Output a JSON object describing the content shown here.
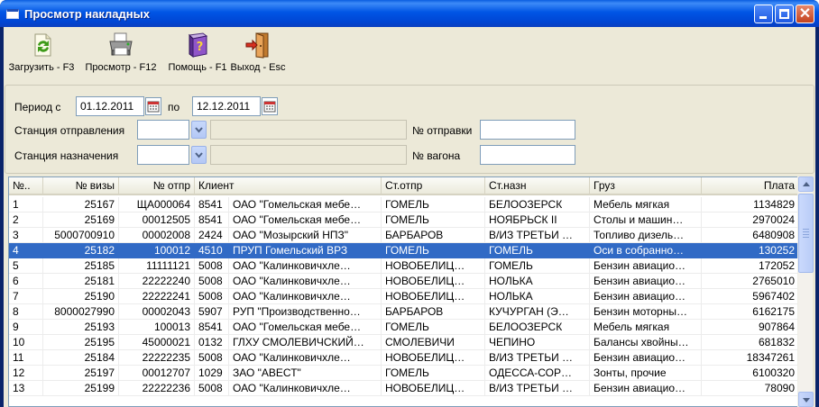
{
  "window": {
    "title": "Просмотр накладных"
  },
  "toolbar": {
    "load_label": "Загрузить - F3",
    "preview_label": "Просмотр - F12",
    "help_label": "Помощь - F1",
    "exit_label": "Выход - Esc"
  },
  "filters": {
    "period_label": "Период с",
    "date_from": "01.12.2011",
    "to_label": "по",
    "date_to": "12.12.2011",
    "station_from_label": "Станция отправления",
    "station_to_label": "Станция назначения",
    "shipment_no_label": "№ отправки",
    "wagon_no_label": "№ вагона"
  },
  "grid": {
    "columns": [
      "№..",
      "№ визы",
      "№ отпр",
      "Клиент",
      "Ст.отпр",
      "Ст.назн",
      "Груз",
      "Плата"
    ],
    "selected_row": 3,
    "rows": [
      [
        "1",
        "25167",
        "ЩА000064",
        "8541",
        "ОАО \"Гомельская мебе…",
        "ГОМЕЛЬ",
        "БЕЛООЗЕРСК",
        "Мебель мягкая",
        "1134829"
      ],
      [
        "2",
        "25169",
        "00012505",
        "8541",
        "ОАО \"Гомельская мебе…",
        "ГОМЕЛЬ",
        "НОЯБРЬСК II",
        "Столы и машин…",
        "2970024"
      ],
      [
        "3",
        "5000700910",
        "00002008",
        "2424",
        "ОАО \"Мозырский НПЗ\"",
        "БАРБАРОВ",
        "В/ИЗ ТРЕТЬИ …",
        "Топливо дизель…",
        "6480908"
      ],
      [
        "4",
        "25182",
        "100012",
        "4510",
        "ПРУП  Гомельский ВРЗ",
        "ГОМЕЛЬ",
        "ГОМЕЛЬ",
        "Оси в собранно…",
        "130252"
      ],
      [
        "5",
        "25185",
        "11111121",
        "5008",
        "ОАО  \"Калинковичхле…",
        "НОВОБЕЛИЦ…",
        "ГОМЕЛЬ",
        "Бензин авиацио…",
        "172052"
      ],
      [
        "6",
        "25181",
        "22222240",
        "5008",
        "ОАО  \"Калинковичхле…",
        "НОВОБЕЛИЦ…",
        "НОЛЬКА",
        "Бензин авиацио…",
        "2765010"
      ],
      [
        "7",
        "25190",
        "22222241",
        "5008",
        "ОАО  \"Калинковичхле…",
        "НОВОБЕЛИЦ…",
        "НОЛЬКА",
        "Бензин авиацио…",
        "5967402"
      ],
      [
        "8",
        "8000027990",
        "00002043",
        "5907",
        "РУП \"Производственно…",
        "БАРБАРОВ",
        "КУЧУРГАН (Э…",
        "Бензин моторны…",
        "6162175"
      ],
      [
        "9",
        "25193",
        "100013",
        "8541",
        "ОАО \"Гомельская мебе…",
        "ГОМЕЛЬ",
        "БЕЛООЗЕРСК",
        "Мебель мягкая",
        "907864"
      ],
      [
        "10",
        "25195",
        "45000021",
        "0132",
        "ГЛХУ СМОЛЕВИЧСКИЙ…",
        "СМОЛЕВИЧИ",
        "ЧЕПИНО",
        "Балансы хвойны…",
        "681832"
      ],
      [
        "11",
        "25184",
        "22222235",
        "5008",
        "ОАО  \"Калинковичхле…",
        "НОВОБЕЛИЦ…",
        "В/ИЗ ТРЕТЬИ …",
        "Бензин авиацио…",
        "18347261"
      ],
      [
        "12",
        "25197",
        "00012707",
        "1029",
        "ЗАО \"АВЕСТ\"",
        "ГОМЕЛЬ",
        "ОДЕССА-СОР…",
        "Зонты, прочие",
        "6100320"
      ],
      [
        "13",
        "25199",
        "22222236",
        "5008",
        "ОАО  \"Калинковичхле…",
        "НОВОБЕЛИЦ…",
        "В/ИЗ ТРЕТЬИ …",
        "Бензин авиацио…",
        "78090"
      ]
    ]
  }
}
